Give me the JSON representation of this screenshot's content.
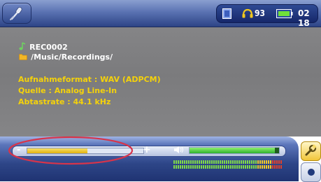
{
  "status": {
    "volume": "93",
    "time": "02 18"
  },
  "file": {
    "name": "REC0002",
    "path": "/Music/Recordings/"
  },
  "details": {
    "format": "Aufnahmeformat : WAV (ADPCM)",
    "source": "Quelle : Analog Line-In",
    "samplerate": "Abtastrate : 44.1 kHz"
  },
  "controls": {
    "minus_label": "-",
    "plus_label": "+",
    "recording_level_fraction": 0.52,
    "volume_fraction": 0.95
  },
  "icons": {
    "back": "microphone-icon",
    "doc": "document-icon",
    "headphones": "headphones-icon",
    "battery": "battery-icon",
    "note": "music-note-icon",
    "folder": "folder-icon",
    "speaker": "speaker-icon",
    "tools": "wrench-icon",
    "record": "record-icon"
  },
  "colors": {
    "accent_text": "#f5d20a",
    "annotation": "#d8344a"
  }
}
